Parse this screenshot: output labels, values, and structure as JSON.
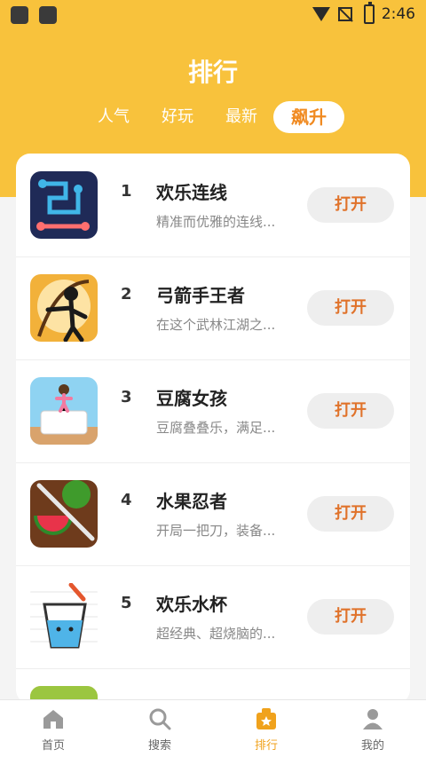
{
  "status_bar": {
    "time": "2:46"
  },
  "page": {
    "title": "排行"
  },
  "tabs": [
    {
      "label": "人气"
    },
    {
      "label": "好玩"
    },
    {
      "label": "最新"
    },
    {
      "label": "飙升",
      "active": true
    }
  ],
  "list": [
    {
      "rank": "1",
      "name": "欢乐连线",
      "desc": "精准而优雅的连线...",
      "button": "打开",
      "icon": "line-puzzle-icon"
    },
    {
      "rank": "2",
      "name": "弓箭手王者",
      "desc": "在这个武林江湖之...",
      "button": "打开",
      "icon": "archer-icon"
    },
    {
      "rank": "3",
      "name": "豆腐女孩",
      "desc": "豆腐叠叠乐，满足...",
      "button": "打开",
      "icon": "tofu-girl-icon"
    },
    {
      "rank": "4",
      "name": "水果忍者",
      "desc": "开局一把刀，装备...",
      "button": "打开",
      "icon": "fruit-ninja-icon"
    },
    {
      "rank": "5",
      "name": "欢乐水杯",
      "desc": "超经典、超烧脑的...",
      "button": "打开",
      "icon": "water-cup-icon"
    }
  ],
  "bottom_nav": [
    {
      "label": "首页",
      "icon": "home-icon"
    },
    {
      "label": "搜索",
      "icon": "search-icon"
    },
    {
      "label": "排行",
      "icon": "ranking-icon",
      "active": true
    },
    {
      "label": "我的",
      "icon": "profile-icon"
    }
  ],
  "colors": {
    "header": "#f8c23c",
    "accent": "#f08a21",
    "button_text": "#e0722a"
  }
}
